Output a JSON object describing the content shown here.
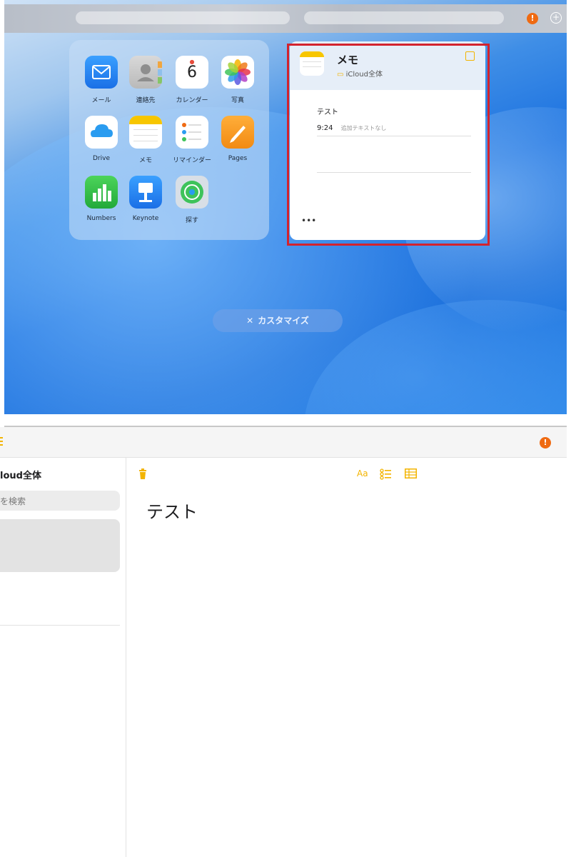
{
  "launcher": {
    "apps": [
      {
        "label": "メール",
        "icon": "mail-icon"
      },
      {
        "label": "連絡先",
        "icon": "contacts-icon"
      },
      {
        "label": "カレンダー",
        "icon": "calendar-icon",
        "day": "6"
      },
      {
        "label": "写真",
        "icon": "photos-icon"
      },
      {
        "label": "Drive",
        "icon": "drive-icon"
      },
      {
        "label": "メモ",
        "icon": "notes-icon"
      },
      {
        "label": "リマインダー",
        "icon": "reminders-icon"
      },
      {
        "label": "Pages",
        "icon": "pages-icon"
      },
      {
        "label": "Numbers",
        "icon": "numbers-icon"
      },
      {
        "label": "Keynote",
        "icon": "keynote-icon"
      },
      {
        "label": "探す",
        "icon": "findmy-icon"
      }
    ],
    "customize_label": "カスタマイズ"
  },
  "notes_widget": {
    "title": "メモ",
    "folder": "iCloud全体",
    "note": {
      "title": "テスト",
      "time": "9:24",
      "preview": "追加テキストなし"
    },
    "more_label": "•••"
  },
  "notes_app": {
    "folder_title": "loud全体",
    "search_placeholder": "を検索",
    "format_label": "Aa",
    "note_title": "テスト"
  },
  "colors": {
    "accent": "#f3b400",
    "alert": "#ef6a12",
    "highlight_frame": "#d3232e"
  }
}
